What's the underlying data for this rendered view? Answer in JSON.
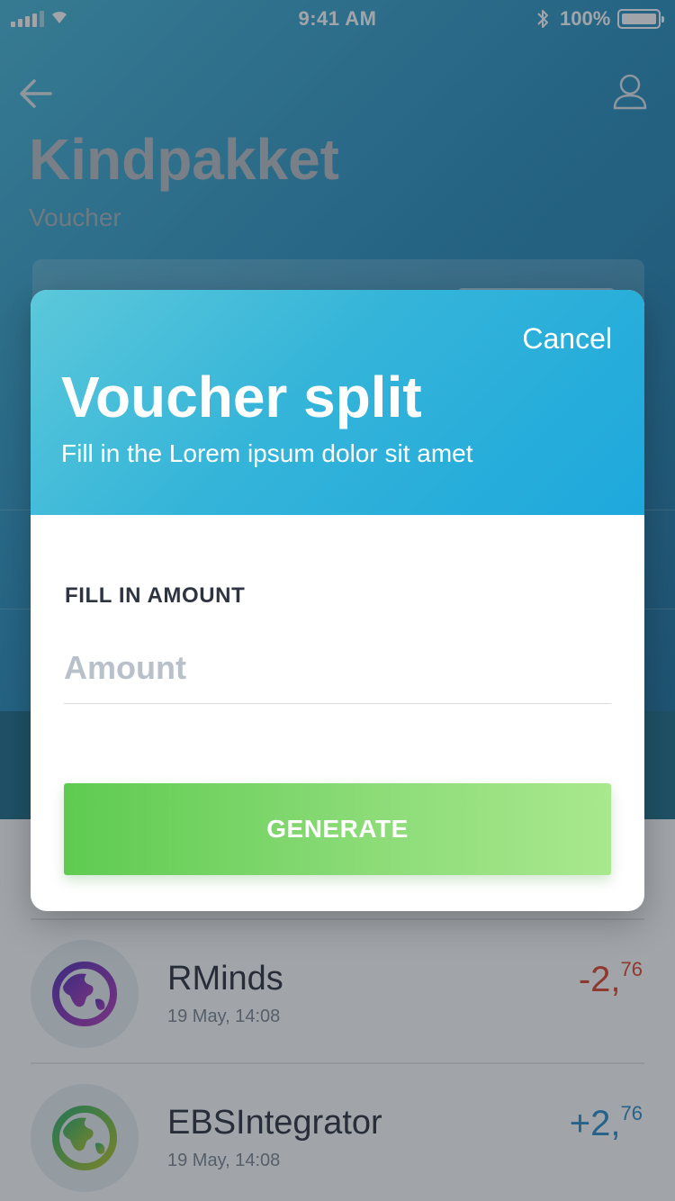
{
  "status_bar": {
    "time": "9:41 AM",
    "battery_percent": "100%",
    "bluetooth_glyph": "∗"
  },
  "header": {
    "title": "Kindpakket",
    "subtitle": "Voucher"
  },
  "transactions": [
    {
      "name": "RMinds",
      "date": "19 May, 14:08",
      "amount_main": "-2,",
      "amount_decimals": "76",
      "type": "debit",
      "icon": "globe-icon",
      "color": "#e0452c"
    },
    {
      "name": "EBSIntegrator",
      "date": "19 May, 14:08",
      "amount_main": "+2,",
      "amount_decimals": "76",
      "type": "credit",
      "icon": "globe-icon",
      "color": "#2c8cc8"
    }
  ],
  "modal": {
    "cancel_label": "Cancel",
    "title": "Voucher split",
    "subtitle": "Fill in the Lorem ipsum dolor sit amet",
    "field_label": "FILL IN AMOUNT",
    "amount_placeholder": "Amount",
    "amount_value": "",
    "generate_label": "GENERATE"
  },
  "colors": {
    "header_gradient_start": "#5cc8da",
    "header_gradient_end": "#1ea8dc",
    "button_gradient_start": "#5ecb50",
    "button_gradient_end": "#a9e88e",
    "negative": "#e0452c",
    "positive": "#2c8cc8"
  }
}
